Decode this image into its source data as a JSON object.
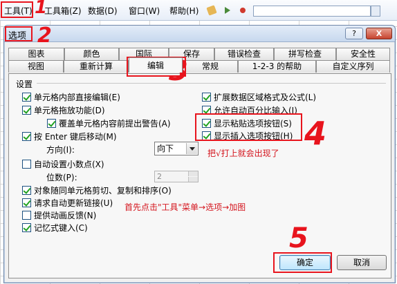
{
  "menubar": {
    "tools_label": "工具(T)",
    "toolbox_label": "工具箱(Z)",
    "data_label": "数据(D)",
    "window_label": "窗口(W)",
    "help_label": "帮助(H)"
  },
  "dialog": {
    "title": "选项",
    "help_button": "?",
    "close_button": "X",
    "tabs_row1": [
      "图表",
      "颜色",
      "国际",
      "保存",
      "错误检查",
      "拼写检查",
      "安全性"
    ],
    "tabs_row2": [
      "视图",
      "重新计算",
      "编辑",
      "常规",
      "1-2-3 的帮助",
      "自定义序列"
    ],
    "active_tab": "编辑",
    "section_title": "设置",
    "left_options": [
      {
        "label": "单元格内部直接编辑(E)",
        "checked": true
      },
      {
        "label": "单元格拖放功能(D)",
        "checked": true
      },
      {
        "label": "覆盖单元格内容前提出警告(A)",
        "checked": true
      },
      {
        "label": "按 Enter 键后移动(M)",
        "checked": true
      },
      {
        "label": "自动设置小数点(X)",
        "checked": false
      },
      {
        "label": "对象随同单元格剪切、复制和排序(O)",
        "checked": true
      },
      {
        "label": "请求自动更新链接(U)",
        "checked": true
      },
      {
        "label": "提供动画反馈(N)",
        "checked": false
      },
      {
        "label": "记忆式键入(C)",
        "checked": true
      }
    ],
    "right_options": [
      {
        "label": "扩展数据区域格式及公式(L)",
        "checked": true
      },
      {
        "label": "允许自动百分比输入(I)",
        "checked": true
      },
      {
        "label": "显示粘贴选项按钮(S)",
        "checked": true
      },
      {
        "label": "显示插入选项按钮(H)",
        "checked": true
      }
    ],
    "direction_label": "方向(I):",
    "direction_value": "向下",
    "places_label": "位数(P):",
    "places_value": "2",
    "ok_button": "确定",
    "cancel_button": "取消"
  },
  "annotations": {
    "step1": "1",
    "step2": "2",
    "step3": "3",
    "step4": "4",
    "step5": "5",
    "note_check": "把√打上就会出现了",
    "note_path": "首先点击\"工具\"菜单→选项→加图"
  },
  "colors": {
    "annotation": "#e8141d",
    "check": "#21a121"
  }
}
